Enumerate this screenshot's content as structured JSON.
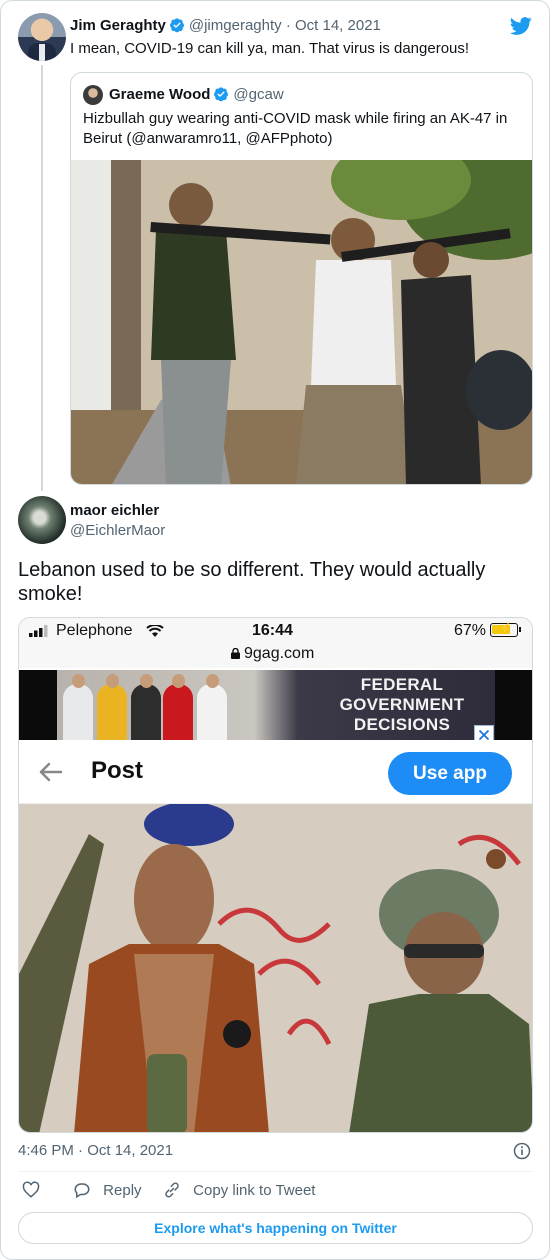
{
  "quoted_reply": {
    "name": "Jim Geraghty",
    "handle": "@jimgeraghty",
    "separator": "·",
    "date": "Oct 14, 2021",
    "text": "I mean, COVID-19 can kill ya, man. That virus is dangerous!",
    "quote": {
      "name": "Graeme Wood",
      "handle": "@gcaw",
      "text": "Hizbullah guy wearing anti-COVID mask while firing an AK-47 in Beirut (@anwaramro11, @AFPphoto)"
    }
  },
  "tweet": {
    "name": "maor eichler",
    "handle": "@EichlerMaor",
    "text": "Lebanon used to be so different. They would actually smoke!",
    "timestamp": "4:46 PM · Oct 14, 2021"
  },
  "screenshot": {
    "carrier": "Pelephone",
    "time": "16:44",
    "battery": "67%",
    "url": "9gag.com",
    "ad_text": [
      "FEDERAL",
      "GOVERNMENT",
      "DECISIONS"
    ],
    "header_title": "Post",
    "use_app_label": "Use app"
  },
  "actions": {
    "reply": "Reply",
    "copy_link": "Copy link to Tweet"
  },
  "explore_label": "Explore what's happening on Twitter",
  "icons": [
    "verified-icon",
    "twitter-bird-icon",
    "heart-icon",
    "reply-icon",
    "link-icon",
    "info-icon",
    "signal-icon",
    "wifi-icon",
    "battery-icon",
    "lock-icon",
    "back-arrow-icon",
    "ad-close-icon"
  ],
  "colors": {
    "twitter_blue": "#1d9bf0",
    "use_app_blue": "#1d8cf5",
    "secondary_text": "#536471",
    "border": "#cfd9de"
  }
}
